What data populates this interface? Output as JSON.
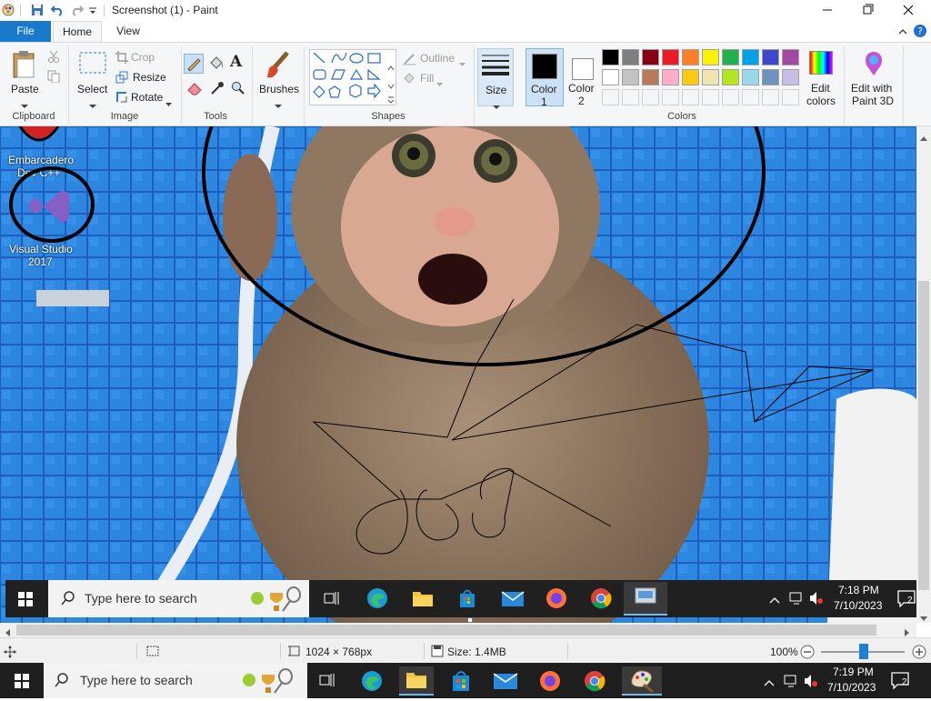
{
  "title_bar": {
    "title": "Screenshot (1) - Paint"
  },
  "tabs": {
    "file": "File",
    "home": "Home",
    "view": "View"
  },
  "ribbon": {
    "clipboard": {
      "paste": "Paste",
      "group": "Clipboard"
    },
    "image": {
      "select": "Select",
      "crop": "Crop",
      "resize": "Resize",
      "rotate": "Rotate",
      "group": "Image"
    },
    "tools": {
      "group": "Tools"
    },
    "brushes": {
      "label": "Brushes"
    },
    "shapes": {
      "outline": "Outline",
      "fill": "Fill",
      "group": "Shapes"
    },
    "size": {
      "label": "Size"
    },
    "color1": {
      "label1": "Color",
      "label2": "1",
      "value": "#000000"
    },
    "color2": {
      "label1": "Color",
      "label2": "2",
      "value": "#ffffff"
    },
    "colors": {
      "group": "Colors",
      "edit_label1": "Edit",
      "edit_label2": "colors"
    },
    "paint3d": {
      "label1": "Edit with",
      "label2": "Paint 3D"
    },
    "palette": [
      "#000000",
      "#7f7f7f",
      "#880015",
      "#ed1c24",
      "#ff7f27",
      "#fff200",
      "#22b14c",
      "#00a2e8",
      "#3f48cc",
      "#a349a4",
      "#ffffff",
      "#c3c3c3",
      "#b97a57",
      "#ffaec9",
      "#ffc90e",
      "#efe4b0",
      "#b5e61d",
      "#99d9ea",
      "#7092be",
      "#c8bfe7"
    ]
  },
  "canvas": {
    "desktop_icons": [
      {
        "label1": "Embarcadero",
        "label2": "Dev C++"
      },
      {
        "label1": "Visual Studio",
        "label2": "2017"
      }
    ],
    "inner_taskbar": {
      "search_placeholder": "Type here to search",
      "time": "7:18 PM",
      "date": "7/10/2023",
      "notifications": "2"
    }
  },
  "status": {
    "dimensions": "1024 × 768px",
    "size": "Size: 1.4MB",
    "zoom": "100%"
  },
  "taskbar": {
    "search_placeholder": "Type here to search",
    "time": "7:19 PM",
    "date": "7/10/2023",
    "notifications": "2"
  }
}
